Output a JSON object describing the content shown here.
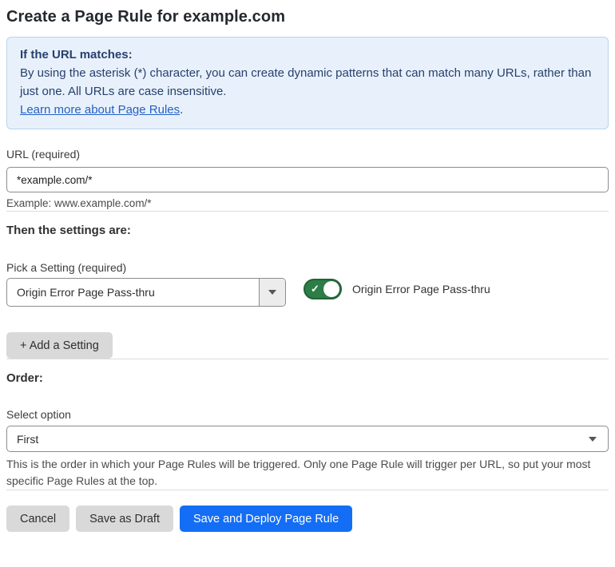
{
  "page": {
    "title": "Create a Page Rule for example.com"
  },
  "info_box": {
    "heading": "If the URL matches:",
    "body": "By using the asterisk (*) character, you can create dynamic patterns that can match many URLs, rather than just one. All URLs are case insensitive.",
    "link_label": "Learn more about Page Rules",
    "link_suffix": "."
  },
  "url_field": {
    "label": "URL (required)",
    "value": "*example.com/*",
    "hint": "Example: www.example.com/*"
  },
  "settings_section": {
    "heading": "Then the settings are:",
    "pick_label": "Pick a Setting (required)",
    "selected_setting": "Origin Error Page Pass-thru",
    "toggle": {
      "state": "on",
      "check_glyph": "✓",
      "label": "Origin Error Page Pass-thru"
    },
    "add_button_label": "+ Add a Setting"
  },
  "order_section": {
    "heading": "Order:",
    "select_label": "Select option",
    "selected_option": "First",
    "help_text": "This is the order in which your Page Rules will be triggered. Only one Page Rule will trigger per URL, so put your most specific Page Rules at the top."
  },
  "footer": {
    "cancel_label": "Cancel",
    "save_draft_label": "Save as Draft",
    "save_deploy_label": "Save and Deploy Page Rule"
  },
  "colors": {
    "info_box_bg": "#e8f1fb",
    "info_box_border": "#b9d3ee",
    "info_box_text": "#27406e",
    "link": "#2361c5",
    "toggle_on_green": "#2d7d46",
    "primary_button_blue": "#146ef5",
    "secondary_button_gray": "#d9d9d9"
  }
}
